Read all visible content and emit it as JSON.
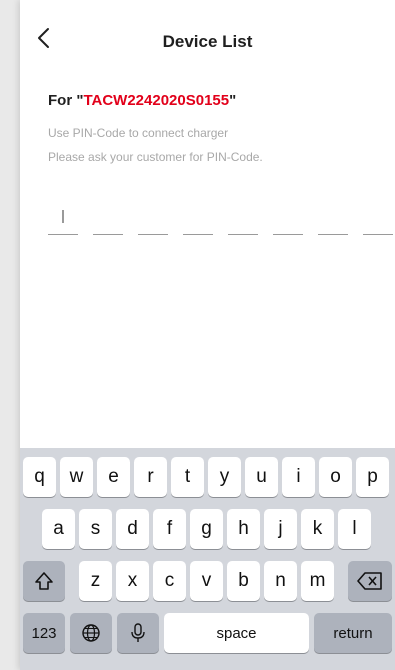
{
  "header": {
    "title": "Device List",
    "back_icon": "chevron-left-icon"
  },
  "content": {
    "for_prefix": "For \"",
    "device_code": "TACW2242020S0155",
    "for_suffix": "\"",
    "hint_line_1": "Use PIN-Code to connect charger",
    "hint_line_2": "Please ask your customer for PIN-Code.",
    "pin_length": 8,
    "pin_value": ""
  },
  "keyboard": {
    "row1": [
      "q",
      "w",
      "e",
      "r",
      "t",
      "y",
      "u",
      "i",
      "o",
      "p"
    ],
    "row2": [
      "a",
      "s",
      "d",
      "f",
      "g",
      "h",
      "j",
      "k",
      "l"
    ],
    "row3": [
      "z",
      "x",
      "c",
      "v",
      "b",
      "n",
      "m"
    ],
    "numbers_label": "123",
    "space_label": "space",
    "return_label": "return",
    "shift_icon": "shift-icon",
    "delete_icon": "backspace-icon",
    "globe_icon": "globe-icon",
    "mic_icon": "microphone-icon"
  },
  "colors": {
    "accent": "#e2001a",
    "keyboard_bg": "#d3d6dc",
    "hint_text": "#a8a8a8"
  }
}
